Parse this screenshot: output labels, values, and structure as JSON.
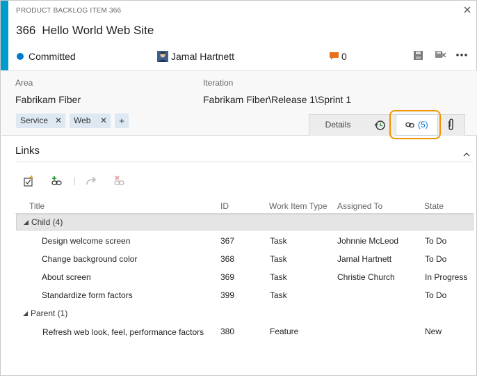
{
  "work_item": {
    "type_label": "PRODUCT BACKLOG ITEM 366",
    "id": "366",
    "title": "Hello World Web Site",
    "state": "Committed",
    "assigned_to": "Jamal Hartnett",
    "comment_count": "0"
  },
  "fields": {
    "area_label": "Area",
    "area_value": "Fabrikam Fiber",
    "iteration_label": "Iteration",
    "iteration_value": "Fabrikam Fiber\\Release 1\\Sprint 1"
  },
  "tags": [
    {
      "label": "Service",
      "remove": "✕"
    },
    {
      "label": "Web",
      "remove": "✕"
    }
  ],
  "tag_add": "+",
  "tabs": {
    "details_label": "Details",
    "links_count": "(5)"
  },
  "links_section": {
    "title": "Links",
    "columns": [
      "Title",
      "ID",
      "Work Item Type",
      "Assigned To",
      "State"
    ],
    "groups": [
      {
        "label": "Child (4)",
        "rows": [
          {
            "title": "Design welcome screen",
            "id": "367",
            "type": "Task",
            "assigned": "Johnnie McLeod",
            "state": "To Do"
          },
          {
            "title": "Change background color",
            "id": "368",
            "type": "Task",
            "assigned": "Jamal Hartnett",
            "state": "To Do"
          },
          {
            "title": "About screen",
            "id": "369",
            "type": "Task",
            "assigned": "Christie Church",
            "state": "In Progress"
          },
          {
            "title": "Standardize form factors",
            "id": "399",
            "type": "Task",
            "assigned": "",
            "state": "To Do"
          }
        ]
      },
      {
        "label": "Parent (1)",
        "rows": [
          {
            "title": "Refresh web look, feel, performance factors",
            "id": "380",
            "type": "Feature",
            "assigned": "",
            "state": "New"
          }
        ]
      }
    ]
  },
  "colors": {
    "accent": "#009ccc",
    "state_committed": "#007acc",
    "link_text": "#007acc",
    "comment_icon": "#e8701a",
    "callout": "#f39200"
  }
}
